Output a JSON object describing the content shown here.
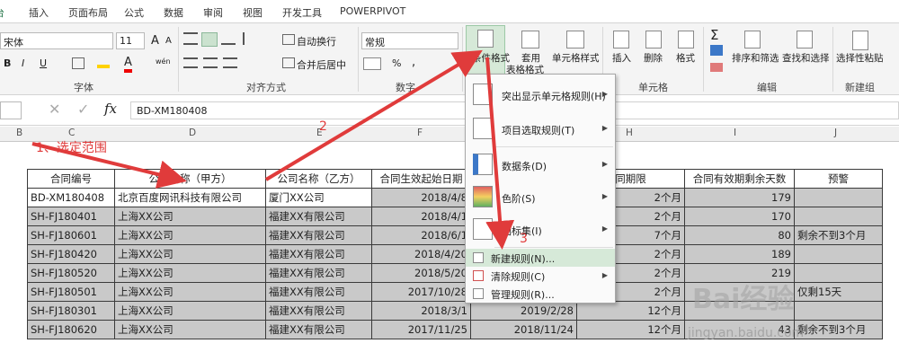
{
  "tabs": [
    "台",
    "插入",
    "页面布局",
    "公式",
    "数据",
    "审阅",
    "视图",
    "开发工具",
    "POWERPIVOT"
  ],
  "ribbon": {
    "font_name": "宋体",
    "font_size": "11",
    "grow_font": "A",
    "shrink_font": "A",
    "bold": "B",
    "italic": "I",
    "underline": "U",
    "font_color_label": "A",
    "phonetic": "wén",
    "wrap_text": "自动换行",
    "merge_center": "合并后居中",
    "number_format": "常规",
    "percent": "%",
    "comma": ",",
    "cond_format": "条件格式",
    "format_table_1": "套用",
    "format_table_2": "表格格式",
    "cell_styles": "单元格样式",
    "insert": "插入",
    "delete": "删除",
    "format": "格式",
    "sigma": "Σ",
    "sort_filter": "排序和筛选",
    "find_select": "查找和选择",
    "paste_select": "选择性粘贴",
    "groups": {
      "font": "字体",
      "alignment": "对齐方式",
      "number": "数字",
      "cells": "单元格",
      "editing": "编辑",
      "new_group": "新建组"
    }
  },
  "formula": {
    "name_box": "",
    "fx": "fx",
    "value": "BD-XM180408"
  },
  "columns": [
    "B",
    "C",
    "D",
    "E",
    "F",
    "H",
    "I",
    "J"
  ],
  "table": {
    "headers": [
      "合同编号",
      "公司名称（甲方）",
      "公司名称（乙方）",
      "合同生效起始日期",
      "",
      "同期限",
      "合同有效期剩余天数",
      "预警"
    ],
    "rows": [
      [
        "BD-XM180408",
        "北京百度网讯科技有限公司",
        "厦门XX公司",
        "2018/4/8",
        "",
        "2个月",
        "179",
        ""
      ],
      [
        "SH-FJ180401",
        "上海XX公司",
        "福建XX有限公司",
        "2018/4/1",
        "",
        "2个月",
        "170",
        ""
      ],
      [
        "SH-FJ180601",
        "上海XX公司",
        "福建XX有限公司",
        "2018/6/1",
        "",
        "7个月",
        "80",
        "剩余不到3个月"
      ],
      [
        "SH-FJ180420",
        "上海XX公司",
        "福建XX有限公司",
        "2018/4/20",
        "",
        "2个月",
        "189",
        ""
      ],
      [
        "SH-FJ180520",
        "上海XX公司",
        "福建XX有限公司",
        "2018/5/20",
        "",
        "2个月",
        "219",
        ""
      ],
      [
        "SH-FJ180501",
        "上海XX公司",
        "福建XX有限公司",
        "2017/10/28",
        "",
        "2个月",
        "",
        "仅剩15天"
      ],
      [
        "SH-FJ180301",
        "上海XX公司",
        "福建XX有限公司",
        "2018/3/1",
        "2019/2/28",
        "12个月",
        "",
        ""
      ],
      [
        "SH-FJ180620",
        "上海XX公司",
        "福建XX有限公司",
        "2017/11/25",
        "2018/11/24",
        "12个月",
        "43",
        "剩余不到3个月"
      ]
    ]
  },
  "menu": {
    "items": [
      "突出显示单元格规则(H)",
      "项目选取规则(T)",
      "数据条(D)",
      "色阶(S)",
      "图标集(I)"
    ],
    "actions": [
      "新建规则(N)...",
      "清除规则(C)",
      "管理规则(R)..."
    ]
  },
  "annotations": {
    "a1": "1、选定范围",
    "a2": "2",
    "a3": "3"
  },
  "watermark": {
    "brand": "Bai经验",
    "url": "jingyan.baidu.com"
  },
  "colors": {
    "accent": "#217346",
    "arrow": "#e03b3b",
    "selection": "#c9c9c9",
    "menu_highlight": "#d6e9d8"
  }
}
